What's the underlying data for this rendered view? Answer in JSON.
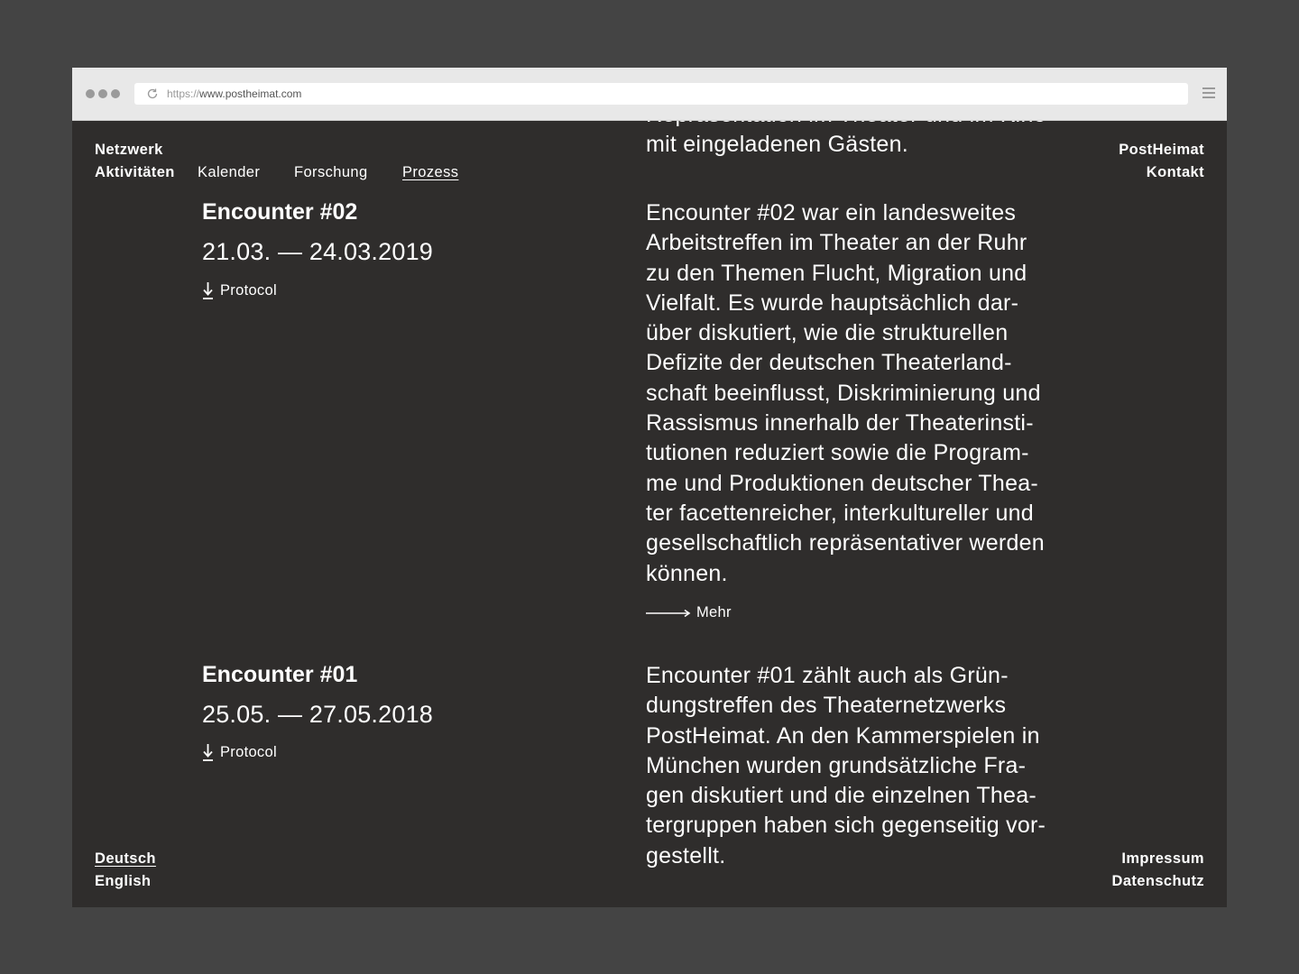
{
  "browser": {
    "url_protocol": "https://",
    "url_host": "www.postheimat.com"
  },
  "nav": {
    "netzwerk": "Netzwerk",
    "aktivitaeten": "Aktivitäten",
    "kalender": "Kalender",
    "forschung": "Forschung",
    "prozess": "Prozess",
    "postheimat": "PostHeimat",
    "kontakt": "Kontakt"
  },
  "intro": {
    "lines": [
      "Repräsentation im Theater und im Kino",
      "mit eingeladenen Gästen."
    ]
  },
  "encounters": [
    {
      "title": "Encounter #02",
      "date": "21.03. — 24.03.2019",
      "protocol_label": "Protocol",
      "lines": [
        "Encounter #02 war ein landesweites",
        "Arbeitstreffen im Theater an der Ruhr",
        "zu den Themen Flucht, Migration und",
        "Vielfalt. Es wurde hauptsächlich dar-",
        "über diskutiert, wie die strukturellen",
        "Defizite der deutschen Theaterland-",
        "schaft beeinflusst, Diskriminierung und",
        "Rassismus innerhalb der Theaterinsti-",
        "tutionen reduziert sowie die Program-",
        "me und Produktionen deutscher Thea-",
        "ter facettenreicher, interkultureller und",
        "gesellschaftlich repräsentativer werden",
        "können."
      ],
      "more_label": "Mehr"
    },
    {
      "title": "Encounter #01",
      "date": "25.05. — 27.05.2018",
      "protocol_label": "Protocol",
      "lines": [
        "Encounter #01 zählt auch als Grün-",
        "dungstreffen des Theaternetzwerks",
        "PostHeimat. An den Kammerspielen in",
        "München wurden grundsätzliche Fra-",
        "gen diskutiert und die einzelnen Thea-",
        "tergruppen haben sich gegenseitig vor-",
        "gestellt."
      ]
    }
  ],
  "footer": {
    "deutsch": "Deutsch",
    "english": "English",
    "impressum": "Impressum",
    "datenschutz": "Datenschutz"
  }
}
